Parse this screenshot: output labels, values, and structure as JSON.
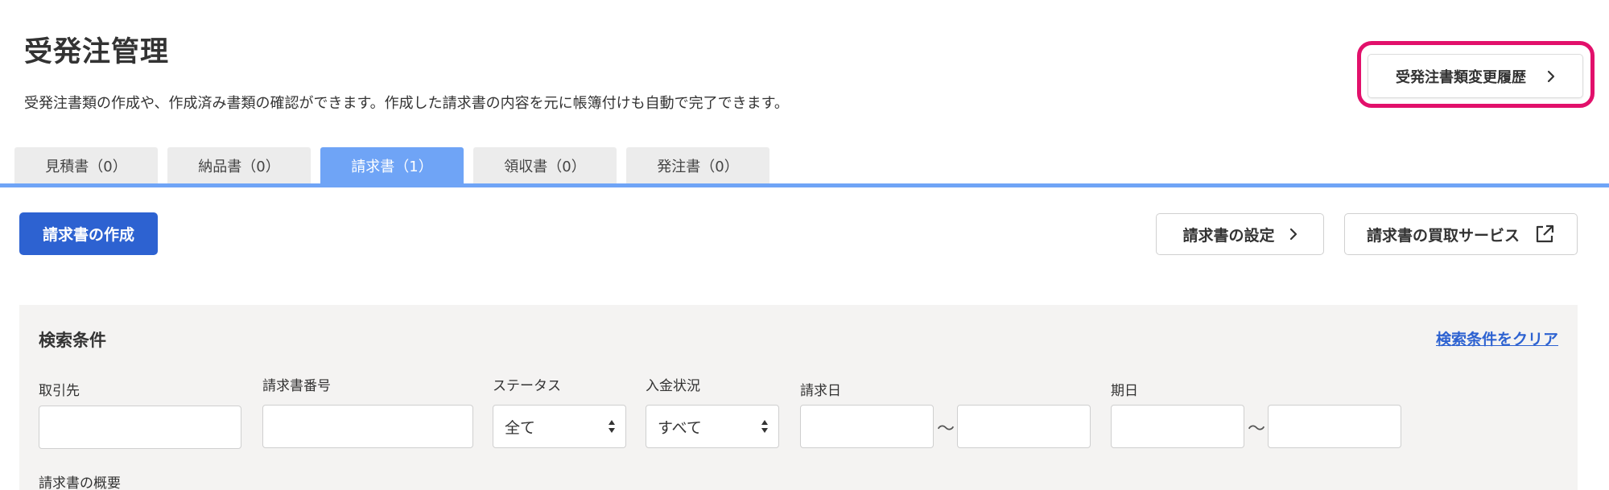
{
  "header": {
    "title": "受発注管理",
    "description": "受発注書類の作成や、作成済み書類の確認ができます。作成した請求書の内容を元に帳簿付けも自動で完了できます。",
    "history_button": "受発注書類変更履歴"
  },
  "tabs": [
    {
      "label": "見積書（0）",
      "active": false
    },
    {
      "label": "納品書（0）",
      "active": false
    },
    {
      "label": "請求書（1）",
      "active": true
    },
    {
      "label": "領収書（0）",
      "active": false
    },
    {
      "label": "発注書（0）",
      "active": false
    }
  ],
  "toolbar": {
    "create_button": "請求書の作成",
    "settings_button": "請求書の設定",
    "purchase_button": "請求書の買取サービス"
  },
  "search": {
    "title": "検索条件",
    "clear_link": "検索条件をクリア",
    "fields": {
      "partner_label": "取引先",
      "invoice_number_label": "請求書番号",
      "status_label": "ステータス",
      "status_value": "全て",
      "payment_label": "入金状況",
      "payment_value": "すべて",
      "invoice_date_label": "請求日",
      "due_date_label": "期日",
      "range_separator": "〜",
      "summary_label": "請求書の概要"
    }
  },
  "icons": {
    "chevron": "chevron-right-icon",
    "external": "external-link-icon",
    "select_arrows": "select-arrows-icon"
  },
  "colors": {
    "primary": "#2d62d1",
    "tab_active": "#6fa4f6",
    "highlight": "#e2106b",
    "panel_bg": "#f4f3f2"
  }
}
